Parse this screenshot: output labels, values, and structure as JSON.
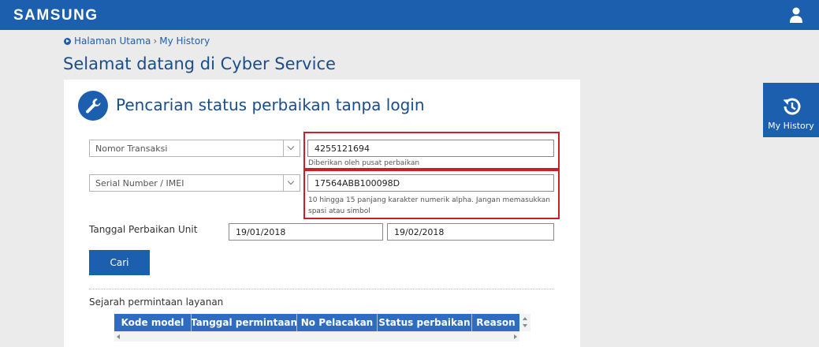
{
  "header": {
    "logo": "SAMSUNG",
    "user_icon": "user-icon"
  },
  "breadcrumb": {
    "home": "Halaman Utama",
    "separator": "›",
    "current": "My History"
  },
  "page_title": "Selamat datang di Cyber Service",
  "section": {
    "icon": "wrench-icon",
    "title": "Pencarian status perbaikan tanpa login"
  },
  "form": {
    "transaction": {
      "select_value": "Nomor Transaksi",
      "input_value": "4255121694",
      "hint": "Diberikan oleh pusat perbaikan"
    },
    "serial": {
      "select_value": "Serial Number / IMEI",
      "input_value": "17564ABB100098D",
      "hint": "10 hingga 15 panjang karakter numerik alpha. Jangan memasukkan spasi atau simbol"
    },
    "date": {
      "label": "Tanggal Perbaikan Unit",
      "from": "19/01/2018",
      "to": "19/02/2018"
    },
    "search_label": "Cari"
  },
  "history": {
    "title": "Sejarah permintaan layanan",
    "columns": [
      "Kode model",
      "Tanggal permintaan",
      "No Pelacakan",
      "Status perbaikan",
      "Reason"
    ]
  },
  "side_button": {
    "icon": "history-icon",
    "label": "My History"
  },
  "colors": {
    "brand_blue": "#1c5fae",
    "title_blue": "#1a4d8c",
    "table_head": "#2f6cc0",
    "highlight_red": "#c8202a"
  }
}
